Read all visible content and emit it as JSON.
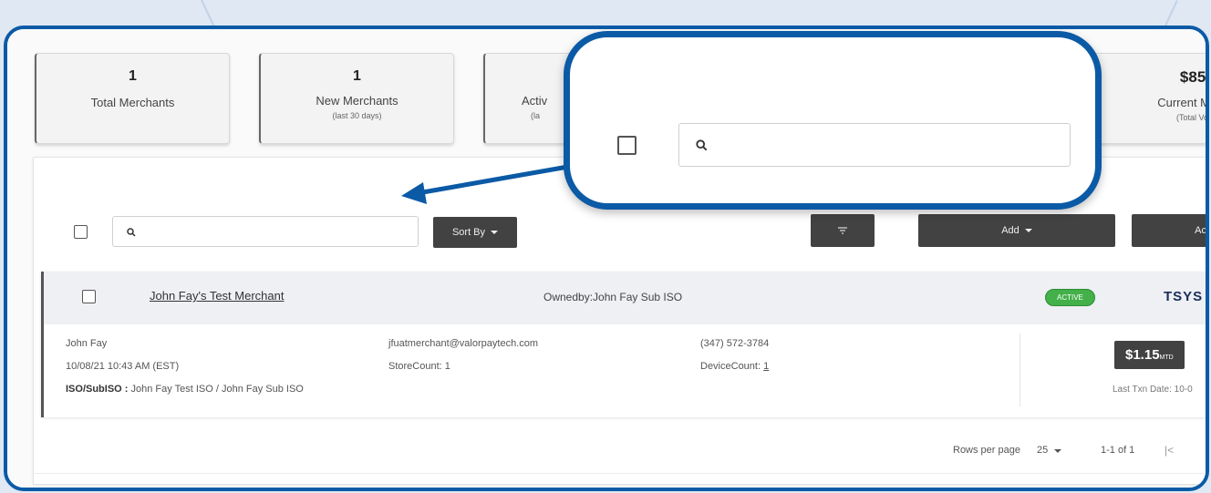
{
  "stats": [
    {
      "value": "1",
      "label": "Total Merchants",
      "sub": ""
    },
    {
      "value": "1",
      "label": "New Merchants",
      "sub": "(last 30 days)"
    },
    {
      "value": "",
      "label": "Activ",
      "sub": "(la"
    },
    {
      "value": "$85,",
      "label": "Current M",
      "sub": "(Total Vol"
    }
  ],
  "toolbar": {
    "search_placeholder": "",
    "sort_label": "Sort By",
    "add_label": "Add",
    "extra_label": "Ac"
  },
  "merchant": {
    "name": "John Fay's Test Merchant",
    "owned_by": "Ownedby:John Fay Sub ISO",
    "status": "ACTIVE",
    "processor": "TSYS",
    "contact": "John Fay",
    "created": "10/08/21 10:43 AM (EST)",
    "iso_label": "ISO/SubISO :",
    "iso_value": "John Fay Test ISO / John Fay Sub ISO",
    "email": "jfuatmerchant@valorpaytech.com",
    "store_count": "StoreCount: 1",
    "phone": "(347) 572-3784",
    "device_count_label": "DeviceCount:",
    "device_count_value": "1",
    "amount": "$1.15",
    "amount_suffix": "MTD",
    "last_txn": "Last Txn Date: 10-0"
  },
  "pagination": {
    "rows_label": "Rows per page",
    "rows_value": "25",
    "range": "1-1 of 1"
  },
  "colors": {
    "frame": "#0b5aa6",
    "dark_button": "#424242",
    "active_badge": "#43b04a"
  }
}
